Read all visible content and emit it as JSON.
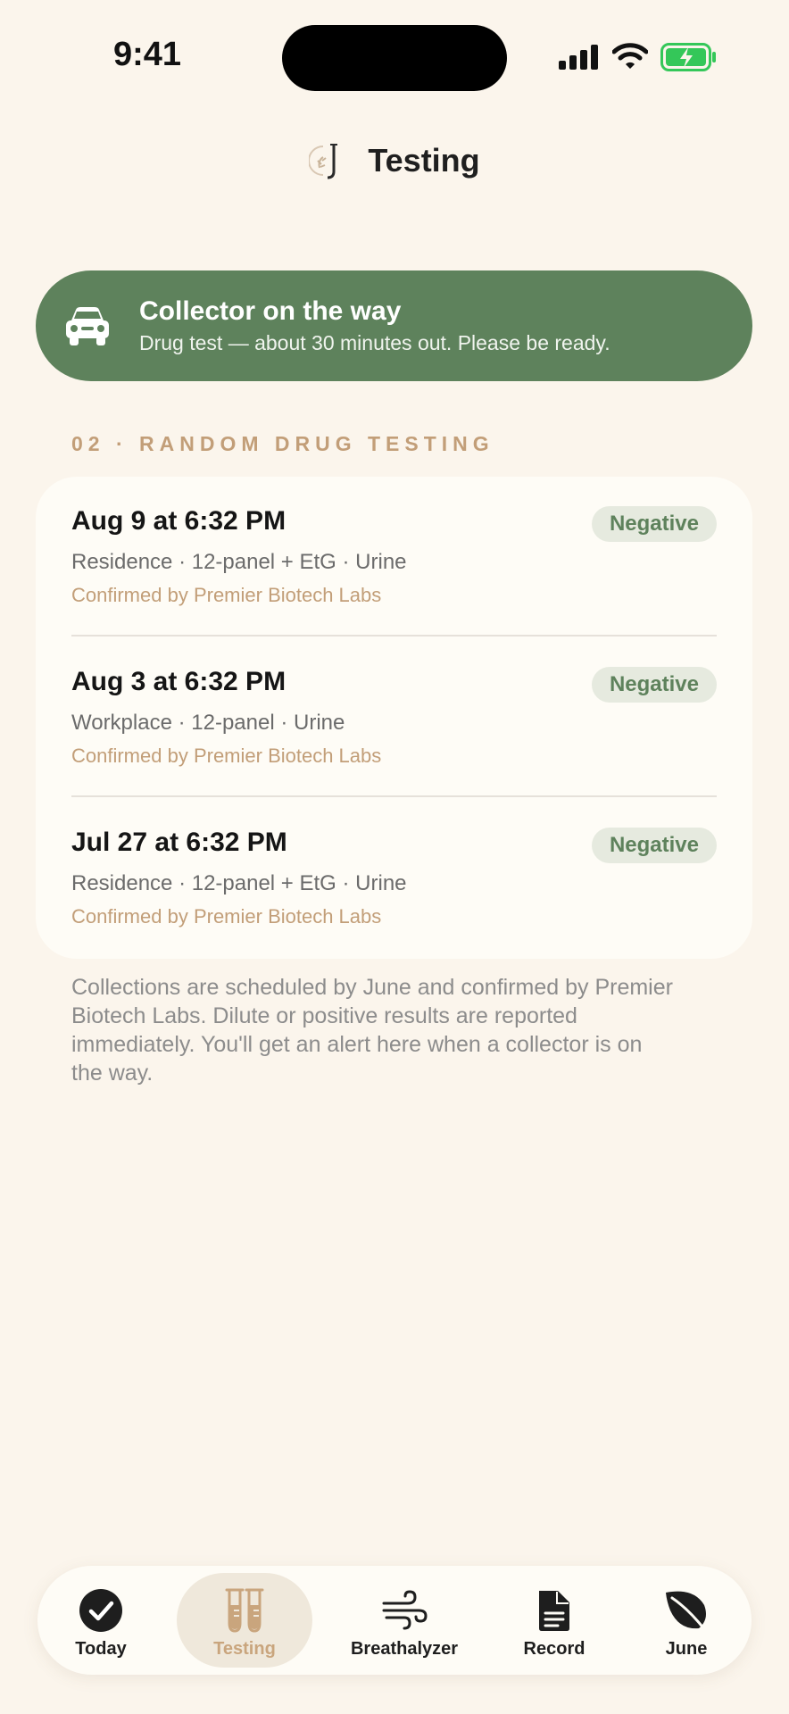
{
  "status_bar": {
    "time": "9:41"
  },
  "header": {
    "title": "Testing"
  },
  "banner": {
    "title": "Collector on the way",
    "subtitle": "Drug test — about 30 minutes out. Please be ready.",
    "icon": "car-icon"
  },
  "section": {
    "label": "02 · RANDOM DRUG TESTING"
  },
  "entries": [
    {
      "date": "Aug 9 at 6:32 PM",
      "detail": "Residence · 12-panel + EtG · Urine",
      "confirmed": "Confirmed by Premier Biotech Labs",
      "result": "Negative"
    },
    {
      "date": "Aug 3 at 6:32 PM",
      "detail": "Workplace · 12-panel · Urine",
      "confirmed": "Confirmed by Premier Biotech Labs",
      "result": "Negative"
    },
    {
      "date": "Jul 27 at 6:32 PM",
      "detail": "Residence · 12-panel + EtG · Urine",
      "confirmed": "Confirmed by Premier Biotech Labs",
      "result": "Negative"
    }
  ],
  "footnote": "Collections are scheduled by June and confirmed by Premier Biotech Labs. Dilute or positive results are reported immediately. You'll get an alert here when a collector is on the way.",
  "tabs": [
    {
      "label": "Today",
      "icon": "checkmark-circle-icon"
    },
    {
      "label": "Testing",
      "icon": "test-tubes-icon",
      "active": true
    },
    {
      "label": "Breathalyzer",
      "icon": "wind-icon"
    },
    {
      "label": "Record",
      "icon": "document-icon"
    },
    {
      "label": "June",
      "icon": "leaf-icon"
    }
  ],
  "colors": {
    "background": "#FBF5EC",
    "banner": "#5E825C",
    "accent": "#C29E78",
    "badge_bg": "#E6EADF",
    "badge_text": "#5E825C"
  }
}
